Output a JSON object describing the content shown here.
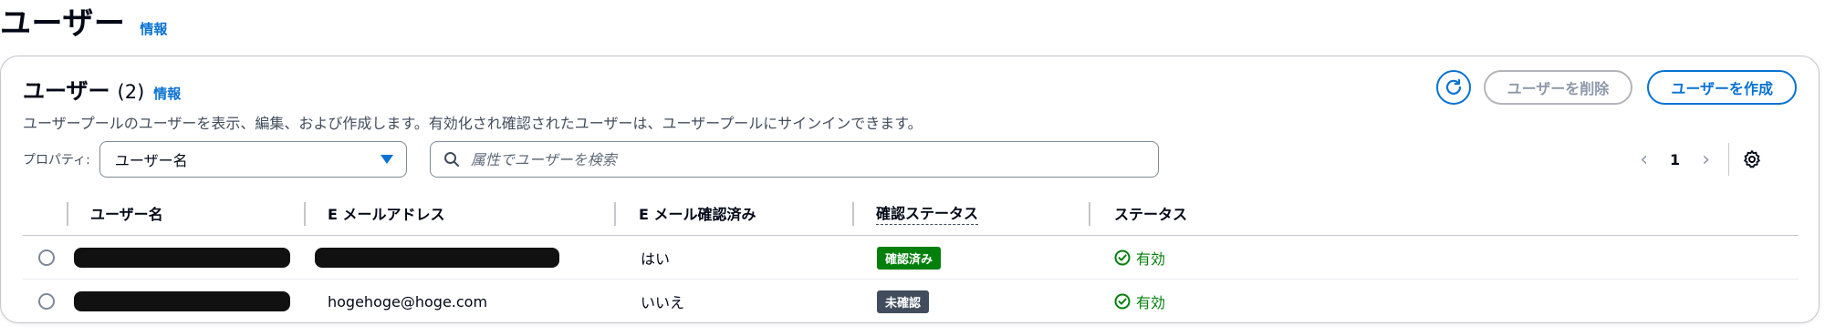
{
  "header": {
    "title": "ユーザー",
    "info": "情報"
  },
  "panel": {
    "title": "ユーザー",
    "count": "(2)",
    "info": "情報",
    "description": "ユーザープールのユーザーを表示、編集、および作成します。有効化され確認されたユーザーは、ユーザープールにサインインできます。",
    "delete_label": "ユーザーを削除",
    "create_label": "ユーザーを作成"
  },
  "filter": {
    "property_label": "プロパティ:",
    "property_value": "ユーザー名",
    "search_placeholder": "属性でユーザーを検索"
  },
  "pagination": {
    "current_page": "1"
  },
  "table": {
    "columns": [
      "ユーザー名",
      "E メールアドレス",
      "E メール確認済み",
      "確認ステータス",
      "ステータス"
    ],
    "rows": [
      {
        "username": "",
        "email": "",
        "email_verified": "はい",
        "confirmation": "確認済み",
        "status": "有効"
      },
      {
        "username": "",
        "email": "hogehoge@hoge.com",
        "email_verified": "いいえ",
        "confirmation": "未確認",
        "status": "有効"
      }
    ]
  },
  "colors": {
    "accent": "#0972d3",
    "success": "#037f0c",
    "neutral_badge": "#414d5c"
  }
}
